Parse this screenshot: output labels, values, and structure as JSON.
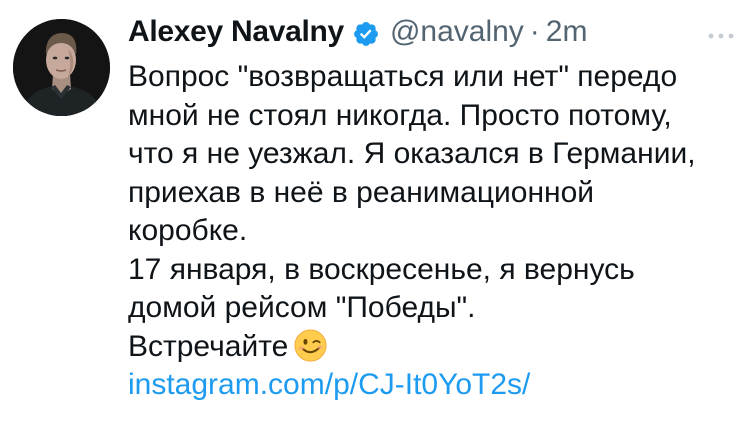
{
  "author": {
    "display_name": "Alexey Navalny",
    "handle": "@navalny",
    "separator": "·",
    "time": "2m",
    "verified_icon": "verified-badge-icon",
    "avatar_icon": "avatar"
  },
  "more_icon": "more-dots-icon",
  "tweet": {
    "lines": [
      "Вопрос \"возвращаться или нет\" передо",
      "мной не стоял никогда. Просто потому,",
      "что я не уезжал. Я оказался в Германии,",
      "приехав в неё в реанимационной",
      "коробке.",
      "17 января, в воскресенье, я вернусь",
      "домой рейсом \"Победы\".",
      "Встречайте"
    ],
    "emoji": "winking-face-emoji",
    "link": "instagram.com/p/CJ-It0YoT2s/"
  },
  "colors": {
    "text": "#0f1419",
    "secondary": "#536471",
    "link": "#1d9bf0",
    "verified": "#1d9bf0"
  }
}
